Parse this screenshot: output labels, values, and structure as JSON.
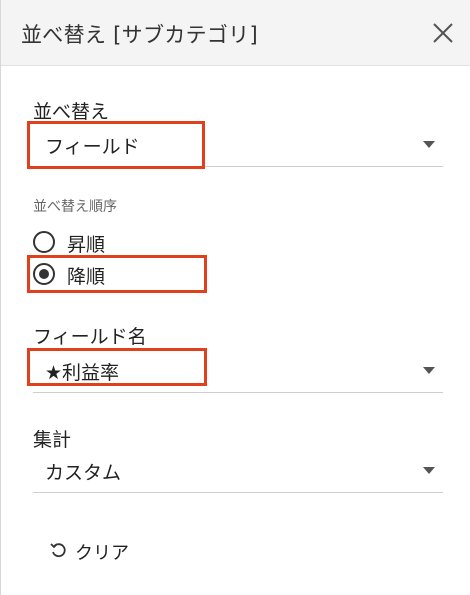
{
  "header": {
    "title": "並べ替え [サブカテゴリ]"
  },
  "sort_by": {
    "label": "並べ替え",
    "selected": "フィールド"
  },
  "sort_order": {
    "label": "並べ替え順序",
    "options": [
      {
        "label": "昇順",
        "selected": false
      },
      {
        "label": "降順",
        "selected": true
      }
    ]
  },
  "field_name": {
    "label": "フィールド名",
    "selected": "★利益率"
  },
  "aggregation": {
    "label": "集計",
    "selected": "カスタム"
  },
  "clear": {
    "label": "クリア"
  },
  "colors": {
    "highlight": "#e0401c",
    "header_bg": "#f4f4f4"
  }
}
